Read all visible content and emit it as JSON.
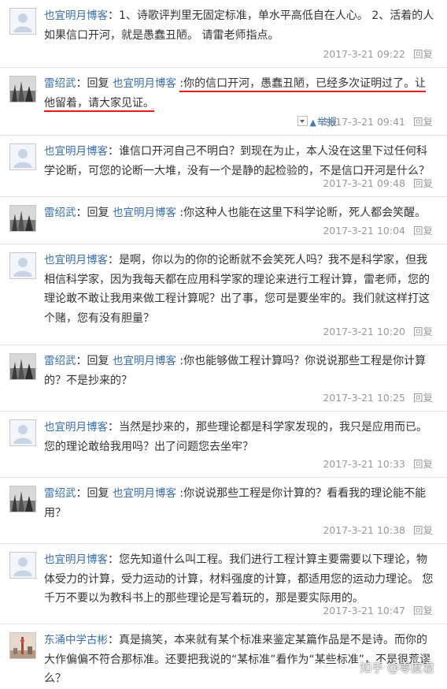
{
  "colors": {
    "username": "#3b6ea5",
    "highlight_underline": "#e01b1b",
    "meta": "#999999"
  },
  "comments": [
    {
      "avatar": "default-avatar-icon",
      "user": "也宜明月博客",
      "text": "1、诗歌评判里无固定标准，单水平高低自在人心。 2、活着的人如果信口开河，就是愚蠢丑陋。 请雷老师指点。",
      "date": "2017-3-21 09:22",
      "reply": "回复"
    },
    {
      "avatar": "landscape-photo-avatar",
      "user": "雷绍武",
      "reply_word": "回复",
      "reply_to": "也宜明月博客",
      "text": ":你的信口开河，愚蠢丑陋，已经多次证明过了。让他留着，请大家见证。",
      "report": "举报",
      "date": "2017-3-21 09:41",
      "reply": "回复"
    },
    {
      "avatar": "default-avatar-icon",
      "user": "也宜明月博客",
      "text": "谁信口开河自己不明白？到现在为止，本人没在这里下过任何科学论断，可您的论断一大堆，没有一个是静的起检验的，不是信口开河是什么？",
      "date": "2017-3-21 09:48",
      "reply": "回复"
    },
    {
      "avatar": "landscape-photo-avatar",
      "user": "雷绍武",
      "reply_word": "回复",
      "reply_to": "也宜明月博客",
      "text": ":你这种人也能在这里下科学论断，死人都会笑醒。",
      "date": "2017-3-21 10:04",
      "reply": "回复"
    },
    {
      "avatar": "default-avatar-icon",
      "user": "也宜明月博客",
      "text": "是啊，你以为的你的论断就不会笑死人吗？我不是科学家，但我相信科学家，因为我每天都在应用科学家的理论来进行工程计算，雷老师，您的理论敢不敢让我用来做工程计算呢？出了事，您可是要坐牢的。我们就这样打这个赌，您有没有胆量？",
      "date": "2017-3-21 10:20",
      "reply": "回复"
    },
    {
      "avatar": "landscape-photo-avatar",
      "user": "雷绍武",
      "reply_word": "回复",
      "reply_to": "也宜明月博客",
      "text": ":你也能够做工程计算吗？你说说那些工程是你计算的？不是抄来的？",
      "date": "2017-3-21 10:25",
      "reply": "回复"
    },
    {
      "avatar": "default-avatar-icon",
      "user": "也宜明月博客",
      "text": "当然是抄来的，那些理论都是科学家发现的，我只是应用而已。您的理论敢给我用吗？出了问题您去坐牢？",
      "date": "2017-3-21 10:33",
      "reply": "回复"
    },
    {
      "avatar": "landscape-photo-avatar",
      "user": "雷绍武",
      "reply_word": "回复",
      "reply_to": "也宜明月博客",
      "text": ":你说说那些工程是你计算的？看看我的理论能不能用？",
      "date": "2017-3-21 10:38",
      "reply": "回复"
    },
    {
      "avatar": "default-avatar-icon",
      "user": "也宜明月博客",
      "text": "您先知道什么叫工程。我们进行工程计算主要需要以下理论，物体受力的计算，受力运动的计算，材料强度的计算，都适用您的运动力理论。 您千万不要以为教科书上的那些理论是写着玩的，那是要实际用的。",
      "date": "2017-3-21 10:47",
      "reply": "回复"
    },
    {
      "avatar": "tower-photo-avatar",
      "user": "东涌中学古彬",
      "text": "真是搞笑，本来就有某个标准来鉴定某篇作品是不是诗。而你的大作偏偏不符合那标准。还要把我说的“某标准”看作为“某些标准”，不是很荒谬么？"
    }
  ],
  "watermark": "知乎 @零度君"
}
